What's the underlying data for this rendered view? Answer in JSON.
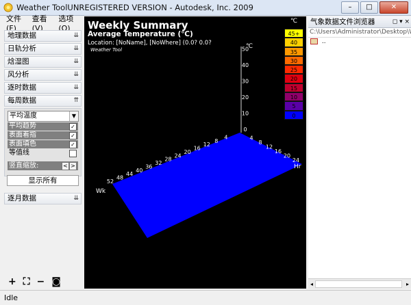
{
  "window": {
    "title": "Weather ToolUNREGISTERED VERSION  -  Autodesk, Inc. 2009",
    "minimize": "–",
    "maximize": "□",
    "close": "✕"
  },
  "menu": {
    "file": "文件(F)",
    "view": "查看(V)",
    "options": "选项(O)"
  },
  "sidebar": {
    "sections": [
      {
        "label": "地理数据",
        "chevron": "⇊"
      },
      {
        "label": "日轨分析",
        "chevron": "⇊"
      },
      {
        "label": "焓湿图",
        "chevron": "⇊"
      },
      {
        "label": "风分析",
        "chevron": "⇊"
      },
      {
        "label": "逐时数据",
        "chevron": "⇊"
      },
      {
        "label": "每周数据",
        "chevron": "⇈"
      }
    ],
    "weekly": {
      "dropdown_value": "平均温度",
      "options": [
        {
          "label": "平均趋势",
          "checked": "✓"
        },
        {
          "label": "表面着指",
          "checked": "✓"
        },
        {
          "label": "表面填色",
          "checked": "✓"
        },
        {
          "label": "等值线",
          "checked": ""
        }
      ],
      "scale_label": "竖直缩放:",
      "scale_left": "<",
      "scale_right": ">",
      "show_all": "显示所有"
    },
    "monthly": {
      "label": "逐月数据",
      "chevron": "⇊"
    },
    "tools": {
      "zoom_in": "+",
      "fit": "⛶",
      "zoom_out": "−",
      "camera": "◙"
    }
  },
  "viewport": {
    "title": "Weekly Summary",
    "subtitle": "Average Temperature (℃)",
    "location": "Location: [NoName], [NoWhere] (0.0? 0.0?",
    "brand": "Weather Tool",
    "surface_color": "#0000ff"
  },
  "chart_data": {
    "type": "heatmap",
    "title": "Weekly Summary",
    "subtitle": "Average Temperature (℃)",
    "z_axis": {
      "label": "℃",
      "ticks": [
        "0",
        "10",
        "20",
        "30",
        "40",
        "50"
      ]
    },
    "week_axis": {
      "label": "Wk",
      "ticks": [
        "4",
        "8",
        "12",
        "16",
        "20",
        "24",
        "28",
        "32",
        "36",
        "40",
        "44",
        "48",
        "52"
      ]
    },
    "hour_axis": {
      "label": "Hr",
      "ticks": [
        "4",
        "8",
        "12",
        "16",
        "20",
        "24"
      ]
    },
    "surface_value": 0
  },
  "legend": {
    "unit": "℃",
    "entries": [
      {
        "label": "45+",
        "color": "#ffff00"
      },
      {
        "label": "40",
        "color": "#ffd000"
      },
      {
        "label": "35",
        "color": "#ff9900"
      },
      {
        "label": "30",
        "color": "#ff6a00"
      },
      {
        "label": "25",
        "color": "#ff2a00"
      },
      {
        "label": "20",
        "color": "#e00010"
      },
      {
        "label": "15",
        "color": "#c0002e"
      },
      {
        "label": "10",
        "color": "#90006a"
      },
      {
        "label": "5",
        "color": "#5a00a8"
      },
      {
        "label": "0",
        "color": "#0000ff"
      }
    ]
  },
  "right_panel": {
    "title": "气象数据文件浏览器",
    "buttons": "◻ ▾ ×",
    "path": "C:\\Users\\Administrator\\Desktop\\We",
    "items": [
      ".."
    ],
    "scroll_left": "◂",
    "scroll_right": "▸"
  },
  "status": {
    "text": "Idle"
  }
}
